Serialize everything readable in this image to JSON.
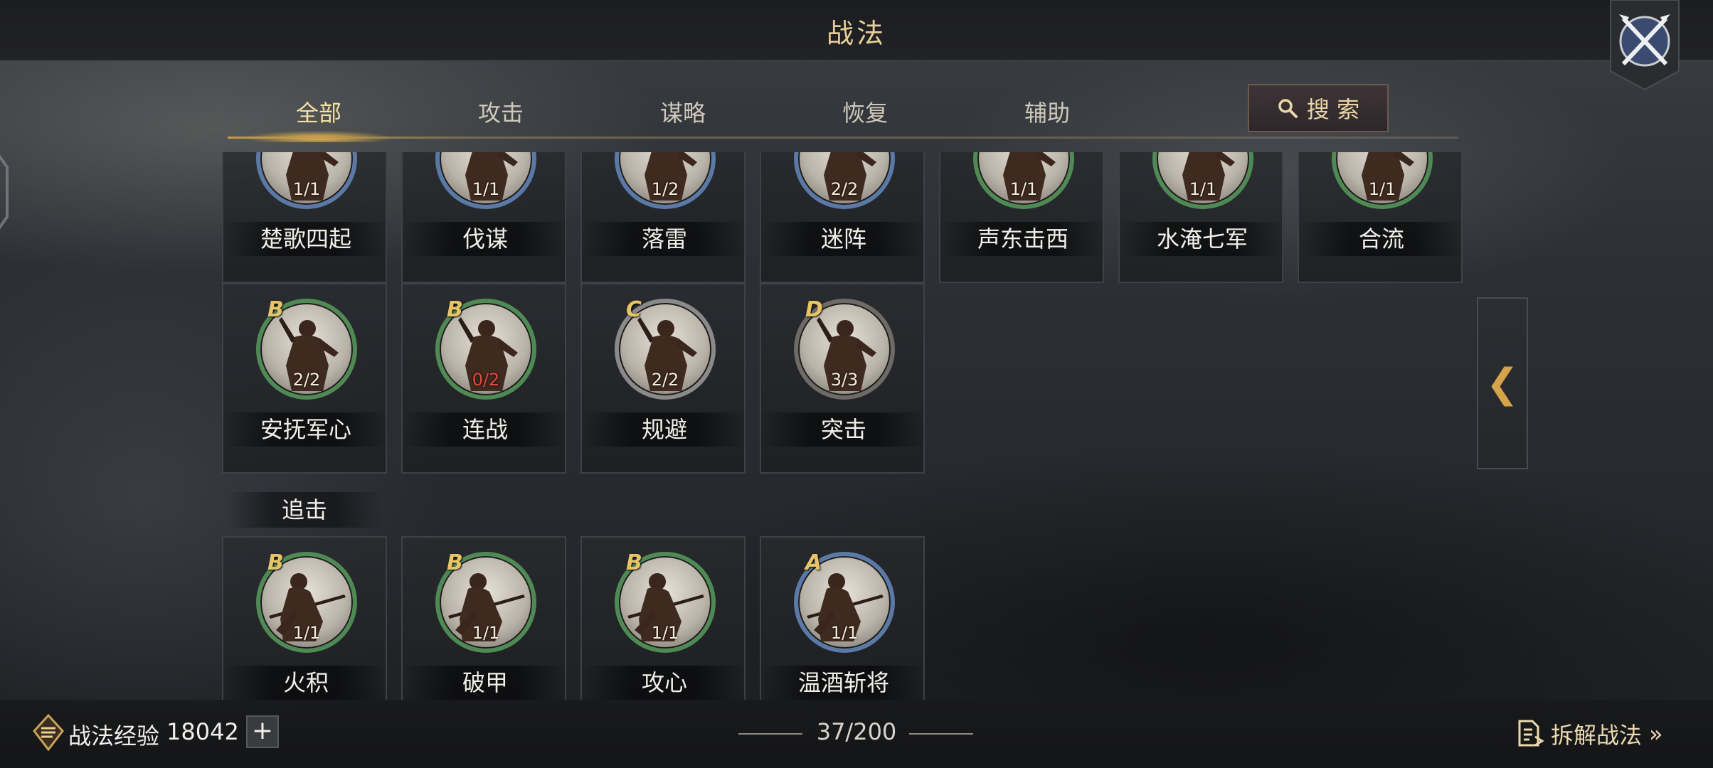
{
  "header": {
    "title": "战法"
  },
  "tabs": [
    {
      "label": "全部",
      "active": true
    },
    {
      "label": "攻击",
      "active": false
    },
    {
      "label": "谋略",
      "active": false
    },
    {
      "label": "恢复",
      "active": false
    },
    {
      "label": "辅助",
      "active": false
    }
  ],
  "search": {
    "label": "搜 索",
    "icon": "search-icon"
  },
  "rows": {
    "top": [
      {
        "name": "楚歌四起",
        "count": "1/1",
        "ring": "#5b79a6"
      },
      {
        "name": "伐谋",
        "count": "1/1",
        "ring": "#5b79a6"
      },
      {
        "name": "落雷",
        "count": "1/2",
        "ring": "#5b79a6"
      },
      {
        "name": "迷阵",
        "count": "2/2",
        "ring": "#5b79a6"
      },
      {
        "name": "声东击西",
        "count": "1/1",
        "ring": "#4f8a55"
      },
      {
        "name": "水淹七军",
        "count": "1/1",
        "ring": "#4f8a55"
      },
      {
        "name": "合流",
        "count": "1/1",
        "ring": "#4f8a55"
      }
    ],
    "middle": [
      {
        "name": "安抚军心",
        "grade": "B",
        "count": "2/2",
        "ring": "#4f8a55",
        "count_warning": false
      },
      {
        "name": "连战",
        "grade": "B",
        "count": "0/2",
        "ring": "#4f8a55",
        "count_warning": true
      },
      {
        "name": "规避",
        "grade": "C",
        "count": "2/2",
        "ring": "#8a8a8a",
        "count_warning": false
      },
      {
        "name": "突击",
        "grade": "D",
        "count": "3/3",
        "ring": "#6e6a66",
        "count_warning": false
      }
    ],
    "section_label": "追击",
    "bottom": [
      {
        "name": "火积",
        "grade": "B",
        "count": "1/1",
        "ring": "#4f8a55"
      },
      {
        "name": "破甲",
        "grade": "B",
        "count": "1/1",
        "ring": "#4f8a55"
      },
      {
        "name": "攻心",
        "grade": "B",
        "count": "1/1",
        "ring": "#4f8a55"
      },
      {
        "name": "温酒斩将",
        "grade": "A",
        "count": "1/1",
        "ring": "#5b79a6"
      }
    ]
  },
  "footer": {
    "exp_label": "战法经验",
    "exp_value": "18042",
    "plus_label": "+",
    "capacity": "37/200",
    "dismantle_label": "拆解战法",
    "dismantle_chevron": "»"
  },
  "collapse_glyph": "❮",
  "colors": {
    "accent_gold": "#e8cf98",
    "warning_red": "#e24a3b"
  }
}
